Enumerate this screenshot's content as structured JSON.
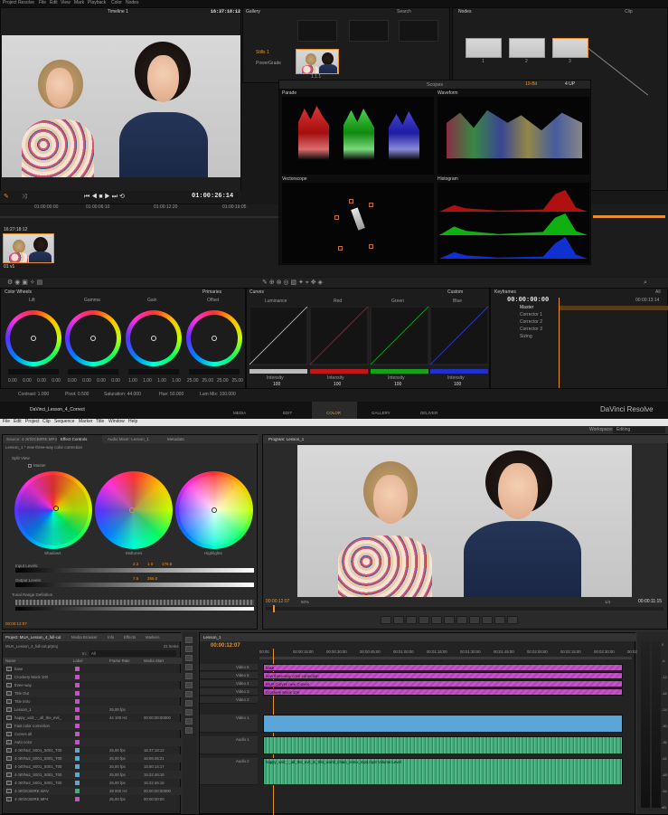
{
  "resolve": {
    "menu": [
      "Project Resolve",
      "File",
      "Edit",
      "View",
      "Mark",
      "Playback",
      "Color",
      "Nodes"
    ],
    "timeline_title": "Timeline 1",
    "viewer_tc": "16:37:18:12",
    "viewer_tc_bottom": "01:00:26:14",
    "ruler_ticks": [
      "01:00:00:00",
      "01:00:06:10",
      "01:00:12:20",
      "01:00:19:05"
    ],
    "clip_tc": "16:27:18:12",
    "clip_label": "01 v1",
    "gallery": {
      "title": "Gallery",
      "search": "Search",
      "stills": "Stills 1",
      "powergrade": "PowerGrade",
      "still_label": "1.1.1"
    },
    "nodes": {
      "title": "Nodes",
      "clip": "Clip",
      "labels": [
        "1",
        "2",
        "3"
      ]
    },
    "scopes": {
      "title": "Scopes",
      "mode": "4 UP",
      "bits": "10-Bit",
      "parade": "Parade",
      "waveform": "Waveform",
      "vectorscope": "Vectorscope",
      "histogram": "Histogram"
    },
    "color_wheels": {
      "title": "Color Wheels",
      "mode": "Primaries",
      "wheels": [
        "Lift",
        "Gamma",
        "Gain",
        "Offset"
      ],
      "values": [
        [
          "0.00",
          "0.00",
          "0.00",
          "0.00"
        ],
        [
          "0.00",
          "0.00",
          "0.00",
          "0.00"
        ],
        [
          "1.00",
          "1.00",
          "1.00",
          "1.00"
        ],
        [
          "25.00",
          "25.00",
          "25.00",
          "25.00"
        ]
      ]
    },
    "bottom_params": {
      "contrast": "Contrast: 1.000",
      "pivot": "Pivot: 0.500",
      "saturation": "Saturation: 44.000",
      "hue": "Hue: 50.000",
      "lum_mix": "Lum Mix: 100.000"
    },
    "curves": {
      "title": "Curves",
      "mode": "Custom",
      "channels": [
        "Luminance",
        "Red",
        "Green",
        "Blue"
      ],
      "intensity_label": "Intensity",
      "intensity_value": "100"
    },
    "keyframes": {
      "title": "Keyframes",
      "all": "All",
      "tc": "00:00:00:00",
      "tc2": "00:00:13:14",
      "rows": [
        "Master",
        "Corrector 1",
        "Corrector 2",
        "Corrector 3",
        "Sizing"
      ]
    },
    "pages": [
      "MEDIA",
      "EDIT",
      "COLOR",
      "GALLERY",
      "DELIVER"
    ],
    "project_name": "DaVinci_Lesson_4_Correct",
    "brand": "DaVinci Resolve"
  },
  "premiere": {
    "menu": [
      "File",
      "Edit",
      "Project",
      "Clip",
      "Sequence",
      "Marker",
      "Title",
      "Window",
      "Help"
    ],
    "workspace_label": "Workspace:",
    "workspace": "Editing",
    "tabs_left": [
      "Source: 4-ЭЛ/2СВ0RE.MP4",
      "Effect Controls",
      "Audio Mixer: Lesson_1",
      "Metadata"
    ],
    "effect_clip": "Lesson_1 * new three-way color correction",
    "split_view": "Split View",
    "master": "Master",
    "wheels": [
      "Shadows",
      "Midtones",
      "Highlights"
    ],
    "input_levels": "Input Levels:",
    "input_values": [
      "2.2",
      "1.0",
      "176.8"
    ],
    "output_levels": "Output Levels:",
    "output_values": [
      "7.5",
      "255.0"
    ],
    "tonal": "Tonal Range Definition",
    "effect_tc": "00:00:12:07",
    "program_tab": "Program: Lesson_1",
    "program_tc": "00:00:12:07",
    "program_zoom": "50%",
    "program_quality": "1/4",
    "program_duration": "00:00:11:15",
    "project": {
      "tabs": [
        "Project: MUA_Lesson_4_full-cut",
        "Media Browser",
        "Info",
        "Effects",
        "Markers"
      ],
      "file": "MUA_Lesson_4_full-cut.prproj",
      "items": "21 Items",
      "in": "In:",
      "in_value": "All",
      "columns": [
        "Name",
        "Label",
        "Frame Rate",
        "Media Start"
      ],
      "rows": [
        {
          "name": "base",
          "fps": "",
          "start": ""
        },
        {
          "name": "Crockery Mock 100",
          "fps": "",
          "start": ""
        },
        {
          "name": "three-way",
          "fps": "",
          "start": ""
        },
        {
          "name": "Title Out",
          "fps": "",
          "start": ""
        },
        {
          "name": "Title intro",
          "fps": "",
          "start": ""
        },
        {
          "name": "Lesson_1",
          "fps": "25,00 fps",
          "start": ""
        },
        {
          "name": "happy_valz_-_all_the_evil_",
          "fps": "44 100 Hz",
          "start": "00:00:00:00000"
        },
        {
          "name": "Fast color correction",
          "fps": "",
          "start": ""
        },
        {
          "name": "Curves all",
          "fps": "",
          "start": ""
        },
        {
          "name": "Auto color",
          "fps": "",
          "start": ""
        },
        {
          "name": "4-ЭЛ/№2_S001_S001_T00",
          "fps": "25,00 fps",
          "start": "16:37:18:12"
        },
        {
          "name": "4-ЭЛ/№2_S001_S001_T00",
          "fps": "25,00 fps",
          "start": "16:06:46:21"
        },
        {
          "name": "4-ЭЛ/№2_S001_S001_T00",
          "fps": "25,00 fps",
          "start": "15:50:14:17"
        },
        {
          "name": "4-ЭЛ/№2_S001_S001_T00",
          "fps": "25,00 fps",
          "start": "15:22:46:15"
        },
        {
          "name": "4-ЭЛ/№2_S001_S001_T00",
          "fps": "25,00 fps",
          "start": "15:22:46:15"
        },
        {
          "name": "4-ЭЛ/2СВ0RE.WAV",
          "fps": "48 000 Hz",
          "start": "00:00:00:00000"
        },
        {
          "name": "4-ЭЛ/2СВ0RE.MP4",
          "fps": "25,00 fps",
          "start": "00:00:00:00"
        }
      ]
    },
    "timeline": {
      "tab": "Lesson_1",
      "tc": "00:00:12:07",
      "ruler": [
        "00:00",
        "00:00:15:00",
        "00:00:30:00",
        "00:00:45:00",
        "00:01:00:00",
        "00:01:15:00",
        "00:01:30:00",
        "00:01:45:00",
        "00:02:00:00",
        "00:02:15:00",
        "00:02:30:00",
        "00:02:45:00"
      ],
      "tracks": [
        "Video 6",
        "Video 5",
        "Video 4",
        "Video 3",
        "Video 2",
        "Video 1",
        "Audio 1",
        "Audio 2"
      ],
      "clips": [
        "base",
        "new three-way color correction",
        "MUA Curves new Curves",
        "Crockery Mock 100",
        "",
        "",
        "",
        "happy_valz_-_all_the_evil_in_this_world_chain_remix_mp3.mp3 Volume:Level"
      ]
    },
    "meter_scale": [
      "0",
      "-6",
      "-12",
      "-18",
      "-24",
      "-30",
      "-36",
      "-42",
      "-48",
      "-54",
      "dB"
    ]
  },
  "colors": {
    "accent_orange": "#e8912c",
    "clip_pink": "#c551c6",
    "clip_green": "#3fae7a",
    "clip_blue": "#5aa6d9"
  }
}
